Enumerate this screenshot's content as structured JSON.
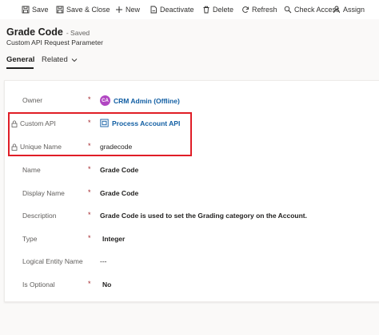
{
  "toolbar": {
    "save_label": "Save",
    "save_close_label": "Save & Close",
    "new_label": "New",
    "deactivate_label": "Deactivate",
    "delete_label": "Delete",
    "refresh_label": "Refresh",
    "check_access_label": "Check Access",
    "assign_label": "Assign"
  },
  "header": {
    "title": "Grade Code",
    "save_status": "- Saved",
    "entity_name": "Custom API Request Parameter"
  },
  "tabs": [
    {
      "label": "General",
      "selected": true
    },
    {
      "label": "Related",
      "selected": false
    }
  ],
  "form": {
    "owner": {
      "label": "Owner",
      "required": "*",
      "value": "CRM Admin (Offline)",
      "avatar_initials": "CA"
    },
    "custom_api": {
      "label": "Custom API",
      "required": "*",
      "value": "Process Account API"
    },
    "unique_name": {
      "label": "Unique Name",
      "required": "*",
      "value": "gradecode"
    },
    "name": {
      "label": "Name",
      "required": "*",
      "value": "Grade Code"
    },
    "display_name": {
      "label": "Display Name",
      "required": "*",
      "value": "Grade Code"
    },
    "description": {
      "label": "Description",
      "required": "*",
      "value": "Grade Code is used to set the Grading category on the Account."
    },
    "type": {
      "label": "Type",
      "required": "*",
      "value": "Integer"
    },
    "logical_entity_name": {
      "label": "Logical Entity Name",
      "value": "---"
    },
    "is_optional": {
      "label": "Is Optional",
      "required": "*",
      "value": "No"
    }
  },
  "colors": {
    "required": "#a4262c",
    "link": "#115ea3",
    "highlight_border": "#e01e27",
    "avatar": "#b146c2"
  }
}
